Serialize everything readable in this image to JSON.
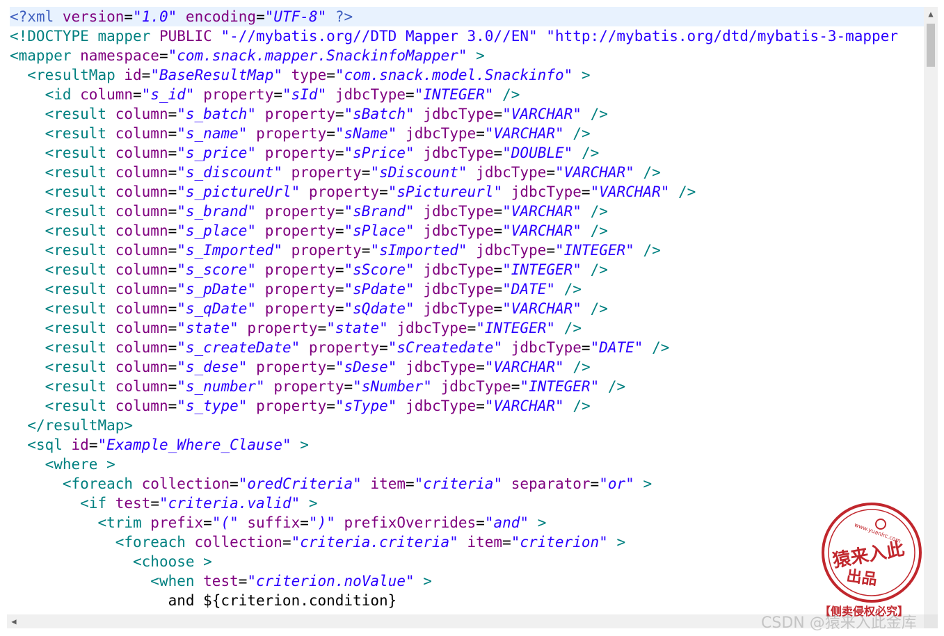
{
  "lines": [
    [
      [
        "pi",
        "<?"
      ],
      [
        "pi",
        "xml "
      ],
      [
        "attr",
        "version"
      ],
      [
        "eq",
        "="
      ],
      [
        "val",
        "\"1.0\""
      ],
      [
        "txt",
        " "
      ],
      [
        "attr",
        "encoding"
      ],
      [
        "eq",
        "="
      ],
      [
        "val",
        "\"UTF-8\""
      ],
      [
        "txt",
        " "
      ],
      [
        "pi",
        "?>"
      ]
    ],
    [
      [
        "tag",
        "<!DOCTYPE "
      ],
      [
        "tag",
        "mapper "
      ],
      [
        "attr",
        "PUBLIC "
      ],
      [
        "val2",
        "\"-//mybatis.org//DTD Mapper 3.0//EN\" "
      ],
      [
        "val2",
        "\"http://mybatis.org/dtd/mybatis-3-mapper"
      ]
    ],
    [
      [
        "tag",
        "<mapper "
      ],
      [
        "attr",
        "namespace"
      ],
      [
        "eq",
        "="
      ],
      [
        "val",
        "\"com.snack.mapper.SnackinfoMapper\""
      ],
      [
        "txt",
        " "
      ],
      [
        "tag",
        ">"
      ]
    ],
    [
      [
        "txt",
        "  "
      ],
      [
        "tag",
        "<resultMap "
      ],
      [
        "attr",
        "id"
      ],
      [
        "eq",
        "="
      ],
      [
        "val",
        "\"BaseResultMap\""
      ],
      [
        "txt",
        " "
      ],
      [
        "attr",
        "type"
      ],
      [
        "eq",
        "="
      ],
      [
        "val",
        "\"com.snack.model.Snackinfo\""
      ],
      [
        "txt",
        " "
      ],
      [
        "tag",
        ">"
      ]
    ],
    [
      [
        "txt",
        "    "
      ],
      [
        "tag",
        "<id "
      ],
      [
        "attr",
        "column"
      ],
      [
        "eq",
        "="
      ],
      [
        "val",
        "\"s_id\""
      ],
      [
        "txt",
        " "
      ],
      [
        "attr",
        "property"
      ],
      [
        "eq",
        "="
      ],
      [
        "val",
        "\"sId\""
      ],
      [
        "txt",
        " "
      ],
      [
        "attr",
        "jdbcType"
      ],
      [
        "eq",
        "="
      ],
      [
        "val",
        "\"INTEGER\""
      ],
      [
        "txt",
        " "
      ],
      [
        "tag",
        "/>"
      ]
    ],
    [
      [
        "txt",
        "    "
      ],
      [
        "tag",
        "<result "
      ],
      [
        "attr",
        "column"
      ],
      [
        "eq",
        "="
      ],
      [
        "val",
        "\"s_batch\""
      ],
      [
        "txt",
        " "
      ],
      [
        "attr",
        "property"
      ],
      [
        "eq",
        "="
      ],
      [
        "val",
        "\"sBatch\""
      ],
      [
        "txt",
        " "
      ],
      [
        "attr",
        "jdbcType"
      ],
      [
        "eq",
        "="
      ],
      [
        "val",
        "\"VARCHAR\""
      ],
      [
        "txt",
        " "
      ],
      [
        "tag",
        "/>"
      ]
    ],
    [
      [
        "txt",
        "    "
      ],
      [
        "tag",
        "<result "
      ],
      [
        "attr",
        "column"
      ],
      [
        "eq",
        "="
      ],
      [
        "val",
        "\"s_name\""
      ],
      [
        "txt",
        " "
      ],
      [
        "attr",
        "property"
      ],
      [
        "eq",
        "="
      ],
      [
        "val",
        "\"sName\""
      ],
      [
        "txt",
        " "
      ],
      [
        "attr",
        "jdbcType"
      ],
      [
        "eq",
        "="
      ],
      [
        "val",
        "\"VARCHAR\""
      ],
      [
        "txt",
        " "
      ],
      [
        "tag",
        "/>"
      ]
    ],
    [
      [
        "txt",
        "    "
      ],
      [
        "tag",
        "<result "
      ],
      [
        "attr",
        "column"
      ],
      [
        "eq",
        "="
      ],
      [
        "val",
        "\"s_price\""
      ],
      [
        "txt",
        " "
      ],
      [
        "attr",
        "property"
      ],
      [
        "eq",
        "="
      ],
      [
        "val",
        "\"sPrice\""
      ],
      [
        "txt",
        " "
      ],
      [
        "attr",
        "jdbcType"
      ],
      [
        "eq",
        "="
      ],
      [
        "val",
        "\"DOUBLE\""
      ],
      [
        "txt",
        " "
      ],
      [
        "tag",
        "/>"
      ]
    ],
    [
      [
        "txt",
        "    "
      ],
      [
        "tag",
        "<result "
      ],
      [
        "attr",
        "column"
      ],
      [
        "eq",
        "="
      ],
      [
        "val",
        "\"s_discount\""
      ],
      [
        "txt",
        " "
      ],
      [
        "attr",
        "property"
      ],
      [
        "eq",
        "="
      ],
      [
        "val",
        "\"sDiscount\""
      ],
      [
        "txt",
        " "
      ],
      [
        "attr",
        "jdbcType"
      ],
      [
        "eq",
        "="
      ],
      [
        "val",
        "\"VARCHAR\""
      ],
      [
        "txt",
        " "
      ],
      [
        "tag",
        "/>"
      ]
    ],
    [
      [
        "txt",
        "    "
      ],
      [
        "tag",
        "<result "
      ],
      [
        "attr",
        "column"
      ],
      [
        "eq",
        "="
      ],
      [
        "val",
        "\"s_pictureUrl\""
      ],
      [
        "txt",
        " "
      ],
      [
        "attr",
        "property"
      ],
      [
        "eq",
        "="
      ],
      [
        "val",
        "\"sPictureurl\""
      ],
      [
        "txt",
        " "
      ],
      [
        "attr",
        "jdbcType"
      ],
      [
        "eq",
        "="
      ],
      [
        "val",
        "\"VARCHAR\""
      ],
      [
        "txt",
        " "
      ],
      [
        "tag",
        "/>"
      ]
    ],
    [
      [
        "txt",
        "    "
      ],
      [
        "tag",
        "<result "
      ],
      [
        "attr",
        "column"
      ],
      [
        "eq",
        "="
      ],
      [
        "val",
        "\"s_brand\""
      ],
      [
        "txt",
        " "
      ],
      [
        "attr",
        "property"
      ],
      [
        "eq",
        "="
      ],
      [
        "val",
        "\"sBrand\""
      ],
      [
        "txt",
        " "
      ],
      [
        "attr",
        "jdbcType"
      ],
      [
        "eq",
        "="
      ],
      [
        "val",
        "\"VARCHAR\""
      ],
      [
        "txt",
        " "
      ],
      [
        "tag",
        "/>"
      ]
    ],
    [
      [
        "txt",
        "    "
      ],
      [
        "tag",
        "<result "
      ],
      [
        "attr",
        "column"
      ],
      [
        "eq",
        "="
      ],
      [
        "val",
        "\"s_place\""
      ],
      [
        "txt",
        " "
      ],
      [
        "attr",
        "property"
      ],
      [
        "eq",
        "="
      ],
      [
        "val",
        "\"sPlace\""
      ],
      [
        "txt",
        " "
      ],
      [
        "attr",
        "jdbcType"
      ],
      [
        "eq",
        "="
      ],
      [
        "val",
        "\"VARCHAR\""
      ],
      [
        "txt",
        " "
      ],
      [
        "tag",
        "/>"
      ]
    ],
    [
      [
        "txt",
        "    "
      ],
      [
        "tag",
        "<result "
      ],
      [
        "attr",
        "column"
      ],
      [
        "eq",
        "="
      ],
      [
        "val",
        "\"s_Imported\""
      ],
      [
        "txt",
        " "
      ],
      [
        "attr",
        "property"
      ],
      [
        "eq",
        "="
      ],
      [
        "val",
        "\"sImported\""
      ],
      [
        "txt",
        " "
      ],
      [
        "attr",
        "jdbcType"
      ],
      [
        "eq",
        "="
      ],
      [
        "val",
        "\"INTEGER\""
      ],
      [
        "txt",
        " "
      ],
      [
        "tag",
        "/>"
      ]
    ],
    [
      [
        "txt",
        "    "
      ],
      [
        "tag",
        "<result "
      ],
      [
        "attr",
        "column"
      ],
      [
        "eq",
        "="
      ],
      [
        "val",
        "\"s_score\""
      ],
      [
        "txt",
        " "
      ],
      [
        "attr",
        "property"
      ],
      [
        "eq",
        "="
      ],
      [
        "val",
        "\"sScore\""
      ],
      [
        "txt",
        " "
      ],
      [
        "attr",
        "jdbcType"
      ],
      [
        "eq",
        "="
      ],
      [
        "val",
        "\"INTEGER\""
      ],
      [
        "txt",
        " "
      ],
      [
        "tag",
        "/>"
      ]
    ],
    [
      [
        "txt",
        "    "
      ],
      [
        "tag",
        "<result "
      ],
      [
        "attr",
        "column"
      ],
      [
        "eq",
        "="
      ],
      [
        "val",
        "\"s_pDate\""
      ],
      [
        "txt",
        " "
      ],
      [
        "attr",
        "property"
      ],
      [
        "eq",
        "="
      ],
      [
        "val",
        "\"sPdate\""
      ],
      [
        "txt",
        " "
      ],
      [
        "attr",
        "jdbcType"
      ],
      [
        "eq",
        "="
      ],
      [
        "val",
        "\"DATE\""
      ],
      [
        "txt",
        " "
      ],
      [
        "tag",
        "/>"
      ]
    ],
    [
      [
        "txt",
        "    "
      ],
      [
        "tag",
        "<result "
      ],
      [
        "attr",
        "column"
      ],
      [
        "eq",
        "="
      ],
      [
        "val",
        "\"s_qDate\""
      ],
      [
        "txt",
        " "
      ],
      [
        "attr",
        "property"
      ],
      [
        "eq",
        "="
      ],
      [
        "val",
        "\"sQdate\""
      ],
      [
        "txt",
        " "
      ],
      [
        "attr",
        "jdbcType"
      ],
      [
        "eq",
        "="
      ],
      [
        "val",
        "\"VARCHAR\""
      ],
      [
        "txt",
        " "
      ],
      [
        "tag",
        "/>"
      ]
    ],
    [
      [
        "txt",
        "    "
      ],
      [
        "tag",
        "<result "
      ],
      [
        "attr",
        "column"
      ],
      [
        "eq",
        "="
      ],
      [
        "val",
        "\"state\""
      ],
      [
        "txt",
        " "
      ],
      [
        "attr",
        "property"
      ],
      [
        "eq",
        "="
      ],
      [
        "val",
        "\"state\""
      ],
      [
        "txt",
        " "
      ],
      [
        "attr",
        "jdbcType"
      ],
      [
        "eq",
        "="
      ],
      [
        "val",
        "\"INTEGER\""
      ],
      [
        "txt",
        " "
      ],
      [
        "tag",
        "/>"
      ]
    ],
    [
      [
        "txt",
        "    "
      ],
      [
        "tag",
        "<result "
      ],
      [
        "attr",
        "column"
      ],
      [
        "eq",
        "="
      ],
      [
        "val",
        "\"s_createDate\""
      ],
      [
        "txt",
        " "
      ],
      [
        "attr",
        "property"
      ],
      [
        "eq",
        "="
      ],
      [
        "val",
        "\"sCreatedate\""
      ],
      [
        "txt",
        " "
      ],
      [
        "attr",
        "jdbcType"
      ],
      [
        "eq",
        "="
      ],
      [
        "val",
        "\"DATE\""
      ],
      [
        "txt",
        " "
      ],
      [
        "tag",
        "/>"
      ]
    ],
    [
      [
        "txt",
        "    "
      ],
      [
        "tag",
        "<result "
      ],
      [
        "attr",
        "column"
      ],
      [
        "eq",
        "="
      ],
      [
        "val",
        "\"s_dese\""
      ],
      [
        "txt",
        " "
      ],
      [
        "attr",
        "property"
      ],
      [
        "eq",
        "="
      ],
      [
        "val",
        "\"sDese\""
      ],
      [
        "txt",
        " "
      ],
      [
        "attr",
        "jdbcType"
      ],
      [
        "eq",
        "="
      ],
      [
        "val",
        "\"VARCHAR\""
      ],
      [
        "txt",
        " "
      ],
      [
        "tag",
        "/>"
      ]
    ],
    [
      [
        "txt",
        "    "
      ],
      [
        "tag",
        "<result "
      ],
      [
        "attr",
        "column"
      ],
      [
        "eq",
        "="
      ],
      [
        "val",
        "\"s_number\""
      ],
      [
        "txt",
        " "
      ],
      [
        "attr",
        "property"
      ],
      [
        "eq",
        "="
      ],
      [
        "val",
        "\"sNumber\""
      ],
      [
        "txt",
        " "
      ],
      [
        "attr",
        "jdbcType"
      ],
      [
        "eq",
        "="
      ],
      [
        "val",
        "\"INTEGER\""
      ],
      [
        "txt",
        " "
      ],
      [
        "tag",
        "/>"
      ]
    ],
    [
      [
        "txt",
        "    "
      ],
      [
        "tag",
        "<result "
      ],
      [
        "attr",
        "column"
      ],
      [
        "eq",
        "="
      ],
      [
        "val",
        "\"s_type\""
      ],
      [
        "txt",
        " "
      ],
      [
        "attr",
        "property"
      ],
      [
        "eq",
        "="
      ],
      [
        "val",
        "\"sType\""
      ],
      [
        "txt",
        " "
      ],
      [
        "attr",
        "jdbcType"
      ],
      [
        "eq",
        "="
      ],
      [
        "val",
        "\"VARCHAR\""
      ],
      [
        "txt",
        " "
      ],
      [
        "tag",
        "/>"
      ]
    ],
    [
      [
        "txt",
        "  "
      ],
      [
        "tag",
        "</resultMap>"
      ]
    ],
    [
      [
        "txt",
        "  "
      ],
      [
        "tag",
        "<sql "
      ],
      [
        "attr",
        "id"
      ],
      [
        "eq",
        "="
      ],
      [
        "val",
        "\"Example_Where_Clause\""
      ],
      [
        "txt",
        " "
      ],
      [
        "tag",
        ">"
      ]
    ],
    [
      [
        "txt",
        "    "
      ],
      [
        "tag",
        "<where "
      ],
      [
        "tag",
        ">"
      ]
    ],
    [
      [
        "txt",
        "      "
      ],
      [
        "tag",
        "<foreach "
      ],
      [
        "attr",
        "collection"
      ],
      [
        "eq",
        "="
      ],
      [
        "val",
        "\"oredCriteria\""
      ],
      [
        "txt",
        " "
      ],
      [
        "attr",
        "item"
      ],
      [
        "eq",
        "="
      ],
      [
        "val",
        "\"criteria\""
      ],
      [
        "txt",
        " "
      ],
      [
        "attr",
        "separator"
      ],
      [
        "eq",
        "="
      ],
      [
        "val",
        "\"or\""
      ],
      [
        "txt",
        " "
      ],
      [
        "tag",
        ">"
      ]
    ],
    [
      [
        "txt",
        "        "
      ],
      [
        "tag",
        "<if "
      ],
      [
        "attr",
        "test"
      ],
      [
        "eq",
        "="
      ],
      [
        "val",
        "\"criteria.valid\""
      ],
      [
        "txt",
        " "
      ],
      [
        "tag",
        ">"
      ]
    ],
    [
      [
        "txt",
        "          "
      ],
      [
        "tag",
        "<trim "
      ],
      [
        "attr",
        "prefix"
      ],
      [
        "eq",
        "="
      ],
      [
        "val",
        "\"(\""
      ],
      [
        "txt",
        " "
      ],
      [
        "attr",
        "suffix"
      ],
      [
        "eq",
        "="
      ],
      [
        "val",
        "\")\""
      ],
      [
        "txt",
        " "
      ],
      [
        "attr",
        "prefixOverrides"
      ],
      [
        "eq",
        "="
      ],
      [
        "val",
        "\"and\""
      ],
      [
        "txt",
        " "
      ],
      [
        "tag",
        ">"
      ]
    ],
    [
      [
        "txt",
        "            "
      ],
      [
        "tag",
        "<foreach "
      ],
      [
        "attr",
        "collection"
      ],
      [
        "eq",
        "="
      ],
      [
        "val",
        "\"criteria.criteria\""
      ],
      [
        "txt",
        " "
      ],
      [
        "attr",
        "item"
      ],
      [
        "eq",
        "="
      ],
      [
        "val",
        "\"criterion\""
      ],
      [
        "txt",
        " "
      ],
      [
        "tag",
        ">"
      ]
    ],
    [
      [
        "txt",
        "              "
      ],
      [
        "tag",
        "<choose "
      ],
      [
        "tag",
        ">"
      ]
    ],
    [
      [
        "txt",
        "                "
      ],
      [
        "tag",
        "<when "
      ],
      [
        "attr",
        "test"
      ],
      [
        "eq",
        "="
      ],
      [
        "val",
        "\"criterion.noValue\""
      ],
      [
        "txt",
        " "
      ],
      [
        "tag",
        ">"
      ]
    ],
    [
      [
        "txt",
        "                  and ${criterion.condition}"
      ]
    ]
  ],
  "watermark": "CSDN @猿来入此金库",
  "stamp": {
    "url_text": "www.yuanlrc.com",
    "line1": "猿来入此",
    "line2": "出品",
    "caption": "【侧卖侵权必究】",
    "color": "#c1272d"
  }
}
